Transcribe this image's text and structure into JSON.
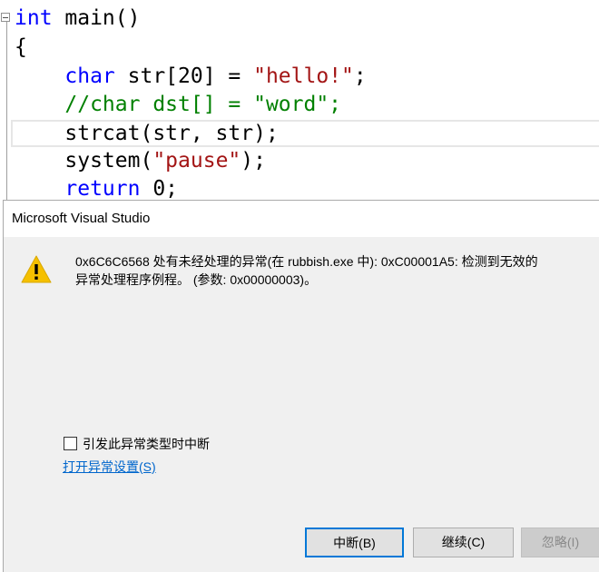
{
  "editor": {
    "lines": [
      {
        "parts": [
          {
            "t": "int",
            "c": "kw"
          },
          {
            "t": " main()",
            "c": ""
          }
        ]
      },
      {
        "parts": [
          {
            "t": "{",
            "c": ""
          }
        ]
      },
      {
        "parts": [
          {
            "t": "    ",
            "c": ""
          },
          {
            "t": "char",
            "c": "kw"
          },
          {
            "t": " str[20] = ",
            "c": ""
          },
          {
            "t": "\"hello!\"",
            "c": "str"
          },
          {
            "t": ";",
            "c": ""
          }
        ]
      },
      {
        "parts": [
          {
            "t": "    ",
            "c": ""
          },
          {
            "t": "//char dst[] = \"word\";",
            "c": "cm"
          }
        ]
      },
      {
        "parts": [
          {
            "t": "    strcat(str, str);",
            "c": ""
          }
        ]
      },
      {
        "parts": [
          {
            "t": "    system(",
            "c": ""
          },
          {
            "t": "\"pause\"",
            "c": "str"
          },
          {
            "t": ");",
            "c": ""
          }
        ]
      },
      {
        "parts": [
          {
            "t": "    ",
            "c": ""
          },
          {
            "t": "return",
            "c": "kw"
          },
          {
            "t": " 0;",
            "c": ""
          }
        ]
      }
    ]
  },
  "dialog": {
    "title": "Microsoft Visual Studio",
    "icon": "warning-icon",
    "message_line1": "0x6C6C6568 处有未经处理的异常(在 rubbish.exe 中): 0xC00001A5: 检测到无效的",
    "message_line2": "异常处理程序例程。 (参数: 0x00000003)。",
    "checkbox_label": "引发此异常类型时中断",
    "checkbox_checked": false,
    "link_text": "打开异常设置(S)",
    "buttons": {
      "break": "中断(B)",
      "continue": "继续(C)",
      "ignore": "忽略(I)"
    },
    "colors": {
      "link": "#0066cc",
      "focus_border": "#0078d7",
      "warning": "#f5c000"
    }
  }
}
